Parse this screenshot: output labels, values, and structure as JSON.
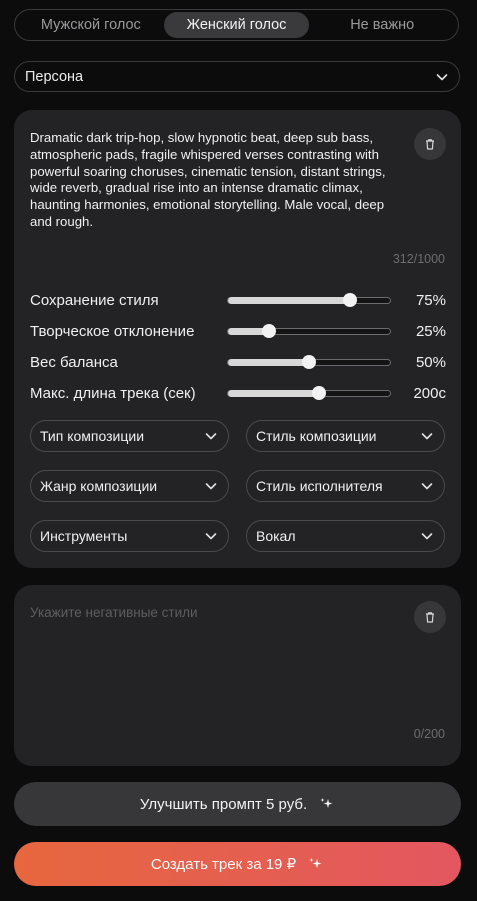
{
  "voice": {
    "options": [
      "Мужской голос",
      "Женский голос",
      "Не важно"
    ],
    "selected": "Женский голос"
  },
  "persona": {
    "label": "Персона"
  },
  "style_prompt": {
    "text": "Dramatic dark trip-hop, slow hypnotic beat, deep sub bass, atmospheric pads, fragile whispered verses contrasting with powerful soaring choruses, cinematic tension, distant strings, wide reverb, gradual rise into an intense dramatic climax, haunting harmonies, emotional storytelling. Male vocal, deep and rough.",
    "counter": "312/1000"
  },
  "sliders": [
    {
      "label": "Сохранение стиля",
      "value": "75%",
      "level": 0.75
    },
    {
      "label": "Творческое отклонение",
      "value": "25%",
      "level": 0.25
    },
    {
      "label": "Вес баланса",
      "value": "50%",
      "level": 0.5
    },
    {
      "label": "Макс. длина трека (сек)",
      "value": "200с",
      "level": 0.56
    }
  ],
  "dropdowns": [
    {
      "label": "Тип композиции"
    },
    {
      "label": "Стиль композиции"
    },
    {
      "label": "Жанр композиции"
    },
    {
      "label": "Стиль исполнителя"
    },
    {
      "label": "Инструменты"
    },
    {
      "label": "Вокал"
    }
  ],
  "negative": {
    "placeholder": "Укажите негативные стили",
    "counter": "0/200"
  },
  "buttons": {
    "improve_label": "Улучшить промпт 5 руб.",
    "create_label": "Создать трек за 19 ₽"
  },
  "colors": {
    "background": "#0c0c0d",
    "card": "#232325",
    "create_gradient_start": "#e7673e",
    "create_gradient_end": "#e35760"
  }
}
